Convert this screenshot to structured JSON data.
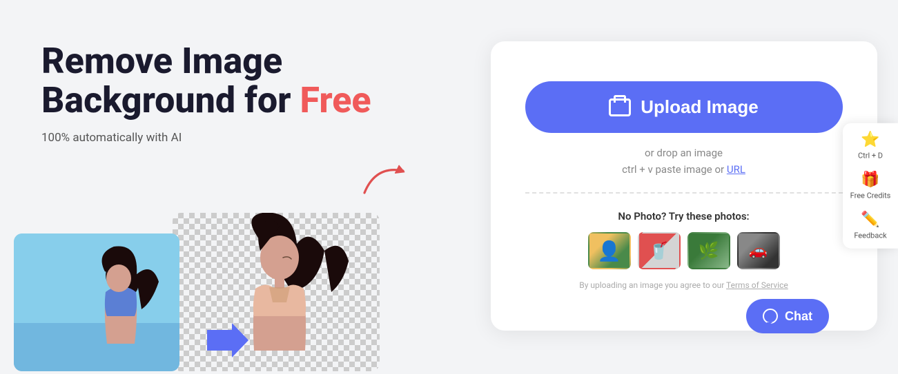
{
  "headline": {
    "line1": "Remove Image",
    "line2_prefix": "Background for ",
    "line2_highlight": "Free"
  },
  "subtitle": "100% automatically with AI",
  "upload_button": {
    "label": "Upload Image"
  },
  "drop_text": "or drop an image",
  "paste_text": "ctrl + v paste image or ",
  "url_label": "URL",
  "sample_photos": {
    "label": "No Photo? Try these photos:",
    "items": [
      {
        "id": "person",
        "emoji": "👤"
      },
      {
        "id": "drink",
        "emoji": "🥤"
      },
      {
        "id": "plant",
        "emoji": "🌿"
      },
      {
        "id": "car",
        "emoji": "🚗"
      }
    ]
  },
  "tos_text": "By uploading an image you agree to our ",
  "tos_link": "Terms of Service",
  "sidebar": {
    "items": [
      {
        "id": "bookmark",
        "icon": "⭐",
        "label": "Ctrl + D"
      },
      {
        "id": "gift",
        "icon": "🎁",
        "label": "Free Credits"
      },
      {
        "id": "feedback",
        "icon": "✏️",
        "label": "Feedback"
      }
    ]
  },
  "chat_button": {
    "label": "Chat"
  }
}
